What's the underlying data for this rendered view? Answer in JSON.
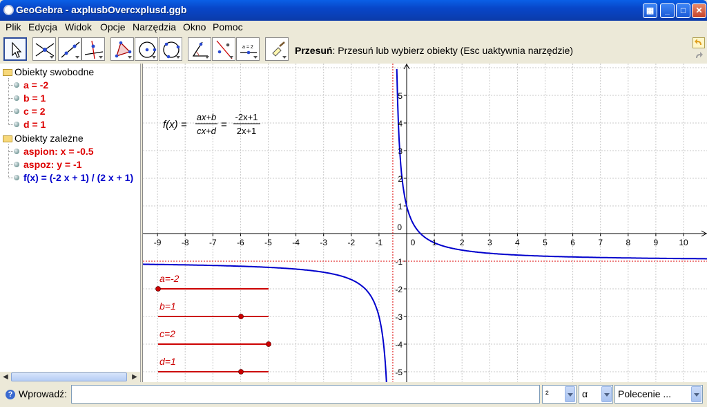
{
  "window": {
    "title": "GeoGebra - axplusbOvercxplusd.ggb",
    "buttons": [
      "grid",
      "minimize",
      "maximize",
      "close"
    ]
  },
  "menu": [
    "Plik",
    "Edycja",
    "Widok",
    "Opcje",
    "Narzędzia",
    "Okno",
    "Pomoc"
  ],
  "toolbar": {
    "tools": [
      "move",
      "point",
      "line",
      "perpendicular",
      "polygon",
      "circle",
      "circle-through-points",
      "angle",
      "reflect",
      "slider",
      "move-graphics"
    ],
    "help_tool": "Przesuń",
    "help_text": ": Przesuń lub wybierz obiekty (Esc uaktywnia narzędzie)",
    "undo_icon": "undo-icon",
    "redo_icon": "redo-icon"
  },
  "algebra": {
    "free_header": "Obiekty swobodne",
    "free": [
      {
        "text": "a = -2",
        "color": "#dd0000"
      },
      {
        "text": "b = 1",
        "color": "#dd0000"
      },
      {
        "text": "c = 2",
        "color": "#dd0000"
      },
      {
        "text": "d = 1",
        "color": "#dd0000"
      }
    ],
    "dependent_header": "Obiekty zależne",
    "dependent": [
      {
        "text": "aspion: x = -0.5",
        "color": "#dd0000"
      },
      {
        "text": "aspoz: y = -1",
        "color": "#dd0000"
      },
      {
        "text": "f(x) = (-2 x + 1) / (2 x + 1)",
        "color": "#0000cc"
      }
    ]
  },
  "graphics": {
    "x_ticks": [
      "-9",
      "-8",
      "-7",
      "-6",
      "-5",
      "-4",
      "-3",
      "-2",
      "-1",
      "0",
      "1",
      "2",
      "3",
      "4",
      "5",
      "6",
      "7",
      "8",
      "9",
      "10"
    ],
    "y_ticks": [
      "5",
      "4",
      "3",
      "2",
      "1",
      "0",
      "-1",
      "-2",
      "-3",
      "-4",
      "-5"
    ],
    "formula": {
      "fx": "f(x) =",
      "num1": "ax+b",
      "den1": "cx+d",
      "eq": "=",
      "num2": "-2x+1",
      "den2": "2x+1"
    },
    "sliders": [
      {
        "label": "a=-2",
        "value": -2
      },
      {
        "label": "b=1",
        "value": 1
      },
      {
        "label": "c=2",
        "value": 2
      },
      {
        "label": "d=1",
        "value": 1
      }
    ],
    "slider_range": [
      -2,
      2
    ],
    "function": {
      "a": -2,
      "b": 1,
      "c": 2,
      "d": 1
    },
    "asymptote_x": -0.5,
    "asymptote_y": -1,
    "colors": {
      "function": "#0000cc",
      "asymptote": "#dd0000",
      "slider": "#cc0000",
      "grid": "#c8c8c8"
    }
  },
  "input": {
    "label": "Wprowadź:",
    "value": "",
    "sup": "²",
    "greek": "α",
    "command": "Polecenie ..."
  }
}
